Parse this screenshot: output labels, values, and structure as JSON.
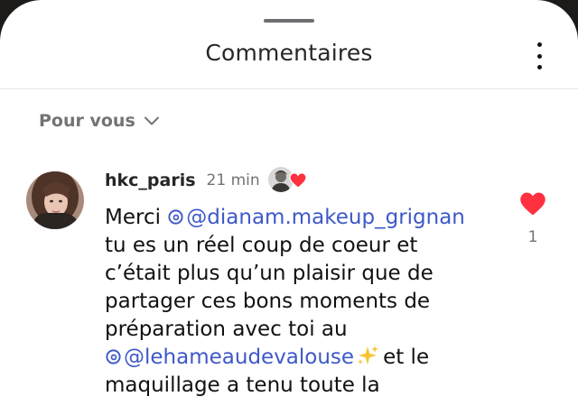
{
  "sheet": {
    "title": "Commentaires",
    "more_icon": "more-vertical-icon"
  },
  "filter": {
    "label": "Pour vous",
    "icon": "chevron-down-icon"
  },
  "comment": {
    "username": "hkc_paris",
    "time": "21 min",
    "liked_by_author": true,
    "lines": [
      "Merci",
      "@dianam.makeup_grignan",
      "tu es un réel coup de coeur et",
      "c’était plus qu’un plaisir que de",
      "partager ces bons moments de",
      "préparation avec toi au",
      "@lehameaudevalouse",
      "✨",
      "et le",
      "maquillage a tenu toute la"
    ],
    "likes": "1",
    "like_icon": "heart-filled-icon",
    "heart_color": "#ff3040",
    "mention_color": "#3e58c9"
  }
}
